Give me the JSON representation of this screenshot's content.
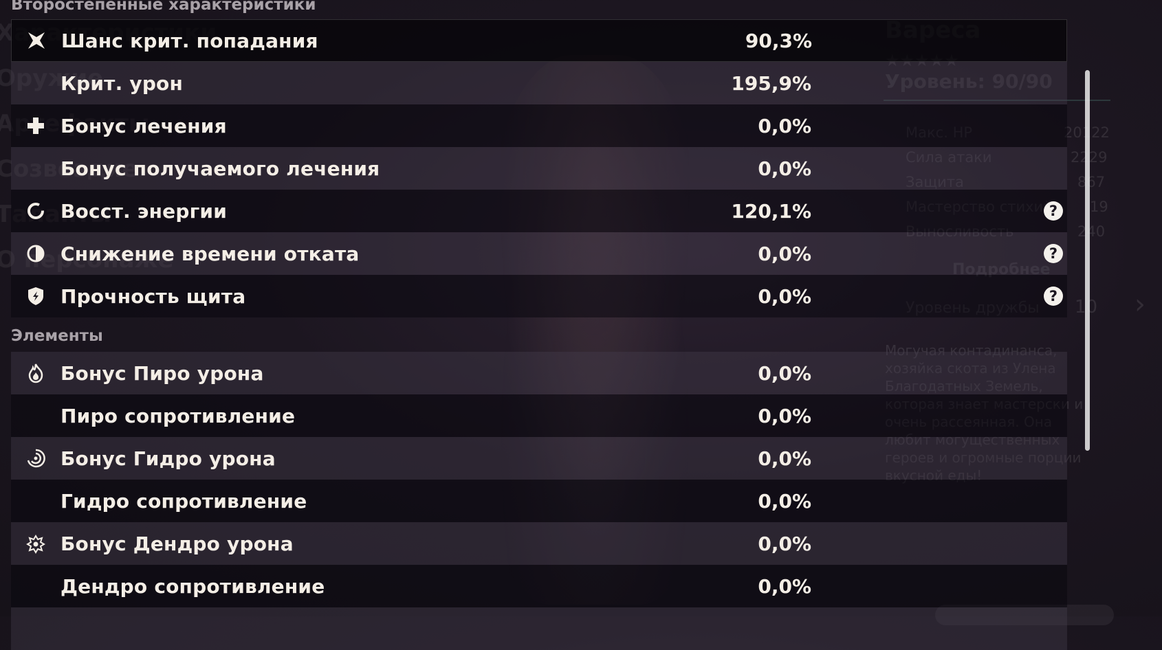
{
  "section_secondary": "Второстепенные характеристики",
  "section_elements": "Элементы",
  "secondary_stats": [
    {
      "icon": "crit-rate-icon",
      "label": "Шанс крит. попадания",
      "value": "90,3%"
    },
    {
      "icon": "",
      "label": "Крит. урон",
      "value": "195,9%"
    },
    {
      "icon": "healing-bonus-icon",
      "label": "Бонус лечения",
      "value": "0,0%"
    },
    {
      "icon": "",
      "label": "Бонус получаемого лечения",
      "value": "0,0%"
    },
    {
      "icon": "energy-recharge-icon",
      "label": "Восст. энергии",
      "value": "120,1%"
    },
    {
      "icon": "cooldown-reduction-icon",
      "label": "Снижение времени отката",
      "value": "0,0%"
    },
    {
      "icon": "shield-strength-icon",
      "label": "Прочность щита",
      "value": "0,0%"
    }
  ],
  "element_stats": [
    {
      "icon": "pyro-icon",
      "label": "Бонус Пиро урона",
      "value": "0,0%"
    },
    {
      "icon": "",
      "label": "Пиро сопротивление",
      "value": "0,0%"
    },
    {
      "icon": "hydro-icon",
      "label": "Бонус Гидро урона",
      "value": "0,0%"
    },
    {
      "icon": "",
      "label": "Гидро сопротивление",
      "value": "0,0%"
    },
    {
      "icon": "dendro-icon",
      "label": "Бонус Дендро урона",
      "value": "0,0%"
    },
    {
      "icon": "",
      "label": "Дендро сопротивление",
      "value": "0,0%"
    }
  ],
  "help_marker": "?",
  "background_panel": {
    "character_name": "Вареса",
    "level_text": "Уровень: 90/90",
    "stats": [
      {
        "label": "Макс. HP",
        "value": "20122"
      },
      {
        "label": "Сила атаки",
        "value": "2229"
      },
      {
        "label": "Защита",
        "value": "867"
      },
      {
        "label": "Мастерство стихий",
        "value": "19"
      },
      {
        "label": "Выносливость",
        "value": "240"
      }
    ],
    "details_button": "Подробнее",
    "friendship_label": "Уровень дружбы",
    "friendship_value": "10",
    "description": "Могучая контадинанса, хозяйка скота из Улена Благодатных Земель, которая знает мастерски и очень рассеянная. Она любит могущественных героев и огромные порции вкусной еды!"
  },
  "background_left": [
    "Характеристики",
    "Оружие",
    "Артефакты",
    "Созвездие",
    "Таланты",
    "О персонаже"
  ],
  "colors": {
    "text": "#f4eee6",
    "section": "#a9a2a8",
    "help_bg": "#f4f1ec"
  }
}
